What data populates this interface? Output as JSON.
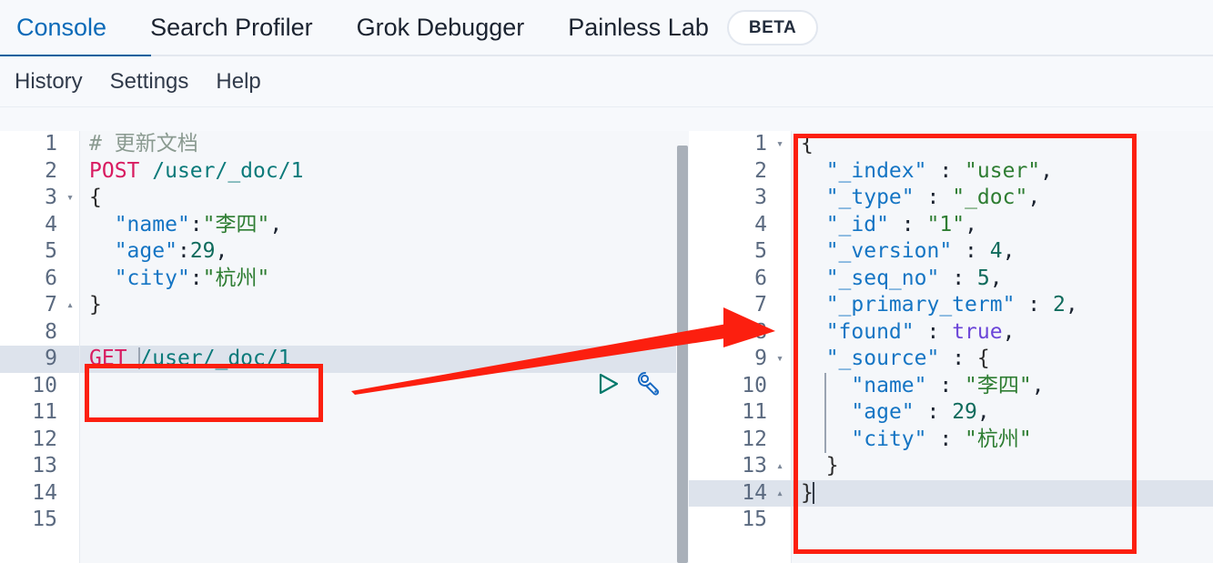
{
  "topnav": {
    "tabs": [
      {
        "label": "Console",
        "active": true
      },
      {
        "label": "Search Profiler",
        "active": false
      },
      {
        "label": "Grok Debugger",
        "active": false
      },
      {
        "label": "Painless Lab",
        "active": false
      }
    ],
    "badge": "BETA"
  },
  "subnav": {
    "items": [
      {
        "label": "History"
      },
      {
        "label": "Settings"
      },
      {
        "label": "Help"
      }
    ]
  },
  "request_editor": {
    "gutter": [
      {
        "n": "1",
        "fold": ""
      },
      {
        "n": "2",
        "fold": ""
      },
      {
        "n": "3",
        "fold": "▾"
      },
      {
        "n": "4",
        "fold": ""
      },
      {
        "n": "5",
        "fold": ""
      },
      {
        "n": "6",
        "fold": ""
      },
      {
        "n": "7",
        "fold": "▴"
      },
      {
        "n": "8",
        "fold": ""
      },
      {
        "n": "9",
        "fold": "",
        "highlight": true
      },
      {
        "n": "10",
        "fold": ""
      },
      {
        "n": "11",
        "fold": ""
      },
      {
        "n": "12",
        "fold": ""
      },
      {
        "n": "13",
        "fold": ""
      },
      {
        "n": "14",
        "fold": ""
      },
      {
        "n": "15",
        "fold": ""
      }
    ],
    "lines": [
      "# 更新文档",
      "POST /user/_doc/1",
      "{",
      "  \"name\":\"李四\",",
      "  \"age\":29,",
      "  \"city\":\"杭州\"",
      "}",
      "",
      "GET /user/_doc/1",
      "",
      "",
      "",
      "",
      "",
      ""
    ],
    "active_line": 9,
    "method": "GET",
    "path": "/user/_doc/1",
    "comment_line": "# 更新文档",
    "post_method": "POST",
    "post_path": "/user/_doc/1",
    "body_keys": [
      "name",
      "age",
      "city"
    ],
    "body_values": [
      "李四",
      "29",
      "杭州"
    ],
    "actions": {
      "play": "play-icon",
      "wrench": "wrench-icon"
    }
  },
  "response_editor": {
    "gutter": [
      {
        "n": "1",
        "fold": "▾"
      },
      {
        "n": "2",
        "fold": ""
      },
      {
        "n": "3",
        "fold": ""
      },
      {
        "n": "4",
        "fold": ""
      },
      {
        "n": "5",
        "fold": ""
      },
      {
        "n": "6",
        "fold": ""
      },
      {
        "n": "7",
        "fold": ""
      },
      {
        "n": "8",
        "fold": ""
      },
      {
        "n": "9",
        "fold": "▾"
      },
      {
        "n": "10",
        "fold": ""
      },
      {
        "n": "11",
        "fold": ""
      },
      {
        "n": "12",
        "fold": ""
      },
      {
        "n": "13",
        "fold": "▴"
      },
      {
        "n": "14",
        "fold": "▴",
        "highlight": true
      },
      {
        "n": "15",
        "fold": ""
      }
    ],
    "active_line": 14,
    "json": {
      "_index": "user",
      "_type": "_doc",
      "_id": "1",
      "_version": "4",
      "_seq_no": "5",
      "_primary_term": "2",
      "found": "true",
      "_source": {
        "name": "李四",
        "age": "29",
        "city": "杭州"
      }
    }
  },
  "annotations": {
    "box_request": "red-highlight-box-get-request",
    "box_response": "red-highlight-box-response",
    "arrow": "red-arrow-request-to-response"
  },
  "colors": {
    "accent": "#00619e",
    "annotation": "#fc1f0f",
    "method": "#d81b60",
    "url": "#0b7a7a",
    "key": "#1575c4",
    "string": "#2e7d32",
    "boolean": "#6b45d8",
    "comment": "#8a9a90"
  }
}
